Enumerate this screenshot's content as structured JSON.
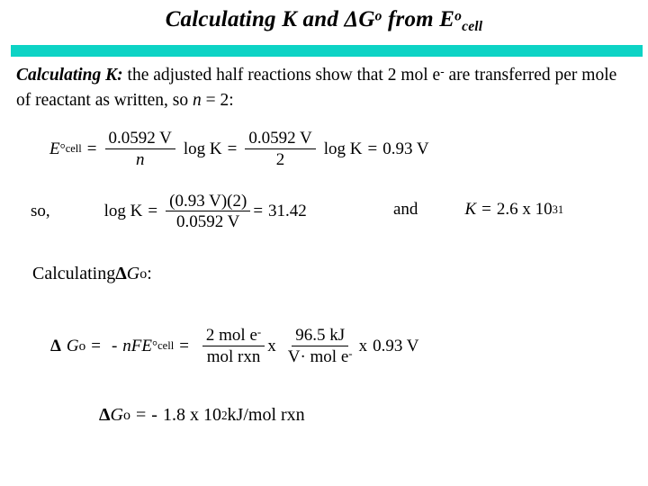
{
  "slide": {
    "title": {
      "text_plain": "Calculating K and ΔGº from Eºcell",
      "part1": "Calculating K and ",
      "delta_g": "ΔG",
      "deg1": "o",
      "part2": " from E",
      "deg2": "o",
      "sub_cell": "cell"
    },
    "divider_color": "#0dd3c5",
    "intro": {
      "lead": "Calculating K:",
      "body_line1": " the adjusted half reactions show that 2 mol e",
      "electron_sup": "-",
      "body_line1_end": " are",
      "body_line2_a": "transferred per mole of reactant as written, so ",
      "var_n": "n",
      "body_line2_b": " = 2:"
    },
    "eq_ecell": {
      "lhs_symbol": "E",
      "lhs_deg": "°",
      "lhs_sub": "cell",
      "equals1": "=",
      "frac1_num": "0.0592 V",
      "frac1_den": "n",
      "log_k_1": "log K",
      "equals2": "=",
      "frac2_num": "0.0592 V",
      "frac2_den": "2",
      "log_k_2": "log K",
      "equals3": "=",
      "result": "0.93 V"
    },
    "eq_logk": {
      "so_label": "so,",
      "log_k": "log K",
      "equals1": "=",
      "frac_num": "(0.93 V)(2)",
      "frac_den": "0.0592 V",
      "equals2": "=",
      "result": "31.42"
    },
    "eq_logk_right": {
      "and_label": "and",
      "k_symbol": "K",
      "equals": "=",
      "value_mantissa": "2.6 x 10",
      "value_exponent": "31"
    },
    "calc_g_heading": {
      "word": "Calculating ",
      "delta": "Δ",
      "g_symbol": " G",
      "deg": "o",
      "colon": " :"
    },
    "eq_dg": {
      "delta": "Δ",
      "g_symbol": "G",
      "g_deg": "o",
      "equals1": "=",
      "minus": "-",
      "nfe": "nFE",
      "nfe_deg": "°",
      "nfe_sub": "cell",
      "equals2": "=",
      "frac1_num": "2 mol e",
      "frac1_num_sup": "-",
      "frac1_den": "mol rxn",
      "times1": "x",
      "frac2_num": "96.5 kJ",
      "frac2_den_a": "V",
      "frac2_den_dot": "·",
      "frac2_den_b": " mol e",
      "frac2_den_sup": "-",
      "times2": "x",
      "final_factor": "0.93 V"
    },
    "eq_final": {
      "delta": "Δ",
      "g_symbol": " G",
      "g_deg": "o",
      "equals": "=",
      "minus": "-",
      "mantissa": "1.8 x 10",
      "exponent": "2",
      "units": " kJ/mol rxn"
    }
  }
}
